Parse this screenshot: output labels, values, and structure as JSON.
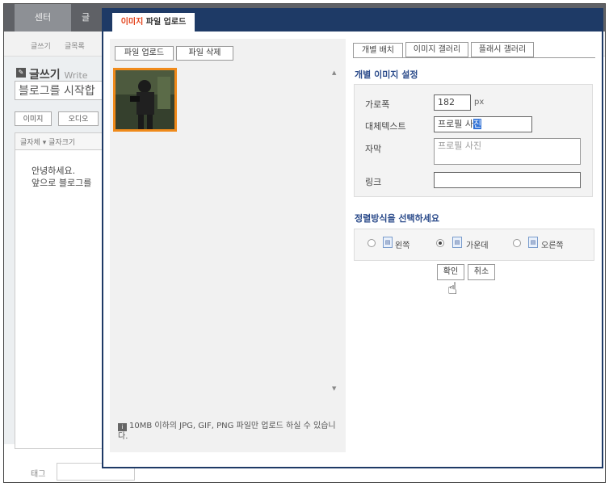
{
  "background": {
    "nav": {
      "center": "센터",
      "write": "글"
    },
    "subnav": [
      "글쓰기",
      "글목록"
    ],
    "write_title": "글쓰기",
    "write_title_en": "Write",
    "title_placeholder": "블로그를 시작합",
    "media_buttons": [
      "이미지",
      "오디오"
    ],
    "font_toolbar": "글자체 ▾  글자크기",
    "body_lines": [
      "안녕하세요.",
      "앞으로 블로그를"
    ],
    "tag_label": "태그"
  },
  "modal": {
    "tab_highlight": "이미지",
    "tab_rest": " 파일 업로드",
    "upload_button": "파일 업로드",
    "delete_button": "파일 삭제",
    "notice": "10MB 이하의 JPG, GIF, PNG 파일만 업로드 하실 수 있습니다.",
    "right_tabs": [
      "개별 배치",
      "이미지 갤러리",
      "플래시 갤러리"
    ],
    "settings_title": "개별 이미지 설정",
    "width_label": "가로폭",
    "width_value": "182",
    "width_unit": "px",
    "alt_label": "대체텍스트",
    "alt_value_plain": "프로필 사",
    "alt_value_selected": "진",
    "caption_label": "자막",
    "caption_value": "프로필 사진",
    "link_label": "링크",
    "link_value": "",
    "align_title": "정렬방식을 선택하세요",
    "align_options": [
      "왼쪽",
      "가운데",
      "오른쪽"
    ],
    "align_selected": "가운데",
    "confirm_button": "확인",
    "cancel_button": "취소"
  },
  "colors": {
    "accent": "#1e3a66",
    "tab_highlight": "#e3441d",
    "thumb_border": "#f08a1a",
    "section_title": "#2a4a8a"
  }
}
